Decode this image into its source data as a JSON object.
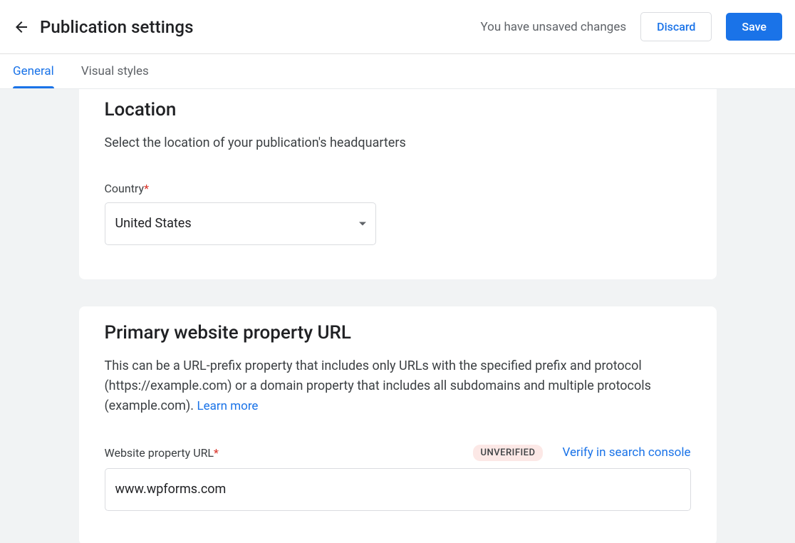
{
  "header": {
    "title": "Publication settings",
    "unsaved_message": "You have unsaved changes",
    "discard_label": "Discard",
    "save_label": "Save"
  },
  "tabs": {
    "general": "General",
    "visual_styles": "Visual styles"
  },
  "location": {
    "title": "Location",
    "description": "Select the location of your publication's headquarters",
    "country_label": "Country",
    "country_value": "United States"
  },
  "website": {
    "title": "Primary website property URL",
    "description": "This can be a URL-prefix property that includes only URLs with the specified prefix and protocol (https://example.com) or a domain property that includes all subdomains and multiple protocols (example.com). ",
    "learn_more": "Learn more",
    "url_label": "Website property URL",
    "url_value": "www.wpforms.com",
    "badge": "UNVERIFIED",
    "verify_link": "Verify in search console"
  }
}
